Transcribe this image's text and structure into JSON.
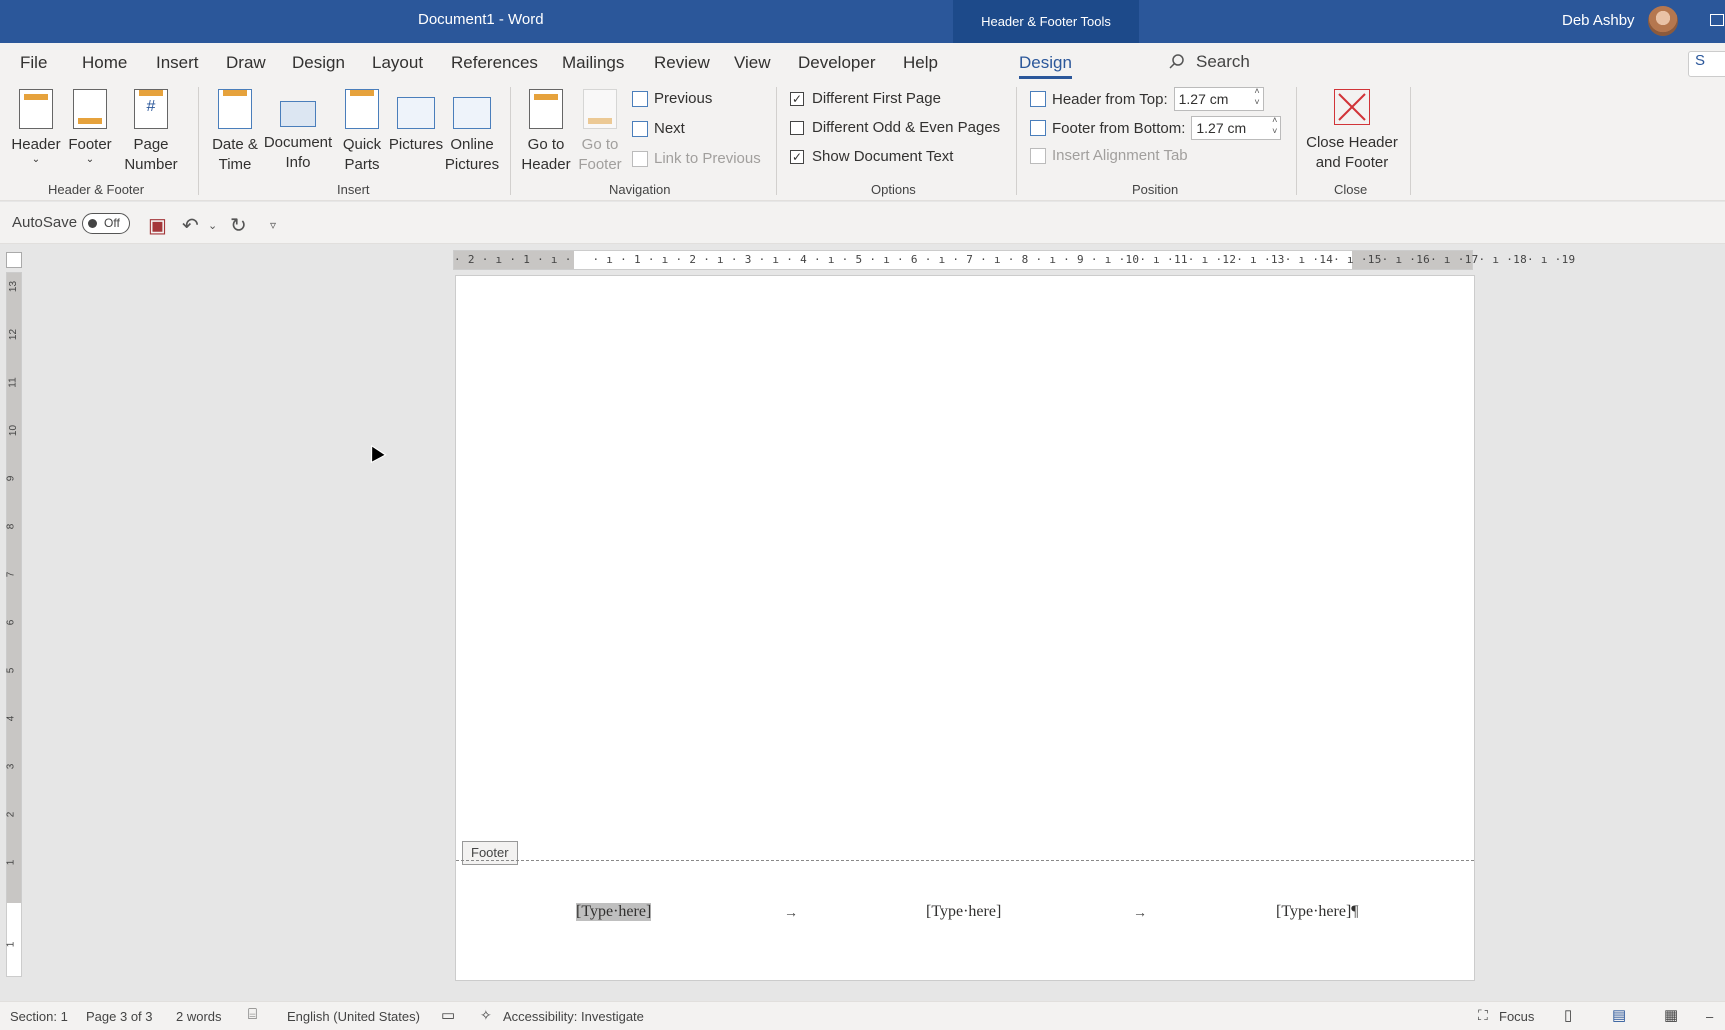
{
  "titlebar": {
    "title": "Document1  -  Word",
    "tools_tab": "Header & Footer Tools",
    "user": "Deb Ashby"
  },
  "menu": {
    "tabs": [
      "File",
      "Home",
      "Insert",
      "Draw",
      "Design",
      "Layout",
      "References",
      "Mailings",
      "Review",
      "View",
      "Developer",
      "Help",
      "Design"
    ],
    "active_tab": "Design",
    "search": "Search",
    "share": "S"
  },
  "ribbon": {
    "groups": {
      "header_footer": "Header & Footer",
      "insert": "Insert",
      "navigation": "Navigation",
      "options": "Options",
      "position": "Position",
      "close": "Close"
    },
    "buttons": {
      "header": "Header",
      "footer": "Footer",
      "page_number_1": "Page",
      "page_number_2": "Number",
      "date_time_1": "Date &",
      "date_time_2": "Time",
      "doc_info_1": "Document",
      "doc_info_2": "Info",
      "quick_parts_1": "Quick",
      "quick_parts_2": "Parts",
      "pictures": "Pictures",
      "online_pictures_1": "Online",
      "online_pictures_2": "Pictures",
      "go_to_header_1": "Go to",
      "go_to_header_2": "Header",
      "go_to_footer_1": "Go to",
      "go_to_footer_2": "Footer",
      "previous": "Previous",
      "next": "Next",
      "link_to_previous": "Link to Previous",
      "close_1": "Close Header",
      "close_2": "and Footer"
    },
    "options": {
      "different_first_page": {
        "label": "Different First Page",
        "checked": true
      },
      "different_odd_even": {
        "label": "Different Odd & Even Pages",
        "checked": false
      },
      "show_document_text": {
        "label": "Show Document Text",
        "checked": true
      }
    },
    "position": {
      "header_from_top_label": "Header from Top:",
      "header_from_top_value": "1.27 cm",
      "footer_from_bottom_label": "Footer from Bottom:",
      "footer_from_bottom_value": "1.27 cm",
      "insert_alignment_tab": "Insert Alignment Tab"
    }
  },
  "qat": {
    "autosave": "AutoSave",
    "toggle": "Off"
  },
  "ruler": {
    "h_numbers": "· 2 · ı · 1 · ı ·   · ı · 1 · ı · 2 · ı · 3 · ı · 4 · ı · 5 · ı · 6 · ı · 7 · ı · 8 · ı · 9 · ı ·10· ı ·11· ı ·12· ı ·13· ı ·14· ı ·15· ı ·16· ı ·17· ı ·18· ı ·19",
    "v_numbers": [
      "13",
      "12",
      "11",
      "10",
      "9",
      "8",
      "7",
      "6",
      "5",
      "4",
      "3",
      "2",
      "1",
      "1"
    ]
  },
  "page": {
    "footer_tag": "Footer",
    "footer_left": "[Type·here]",
    "footer_center": "[Type·here]",
    "footer_right": "[Type·here]¶",
    "tab_arrow": "→"
  },
  "status": {
    "section": "Section: 1",
    "page": "Page 3 of 3",
    "words": "2 words",
    "language": "English (United States)",
    "accessibility": "Accessibility: Investigate",
    "focus": "Focus"
  }
}
